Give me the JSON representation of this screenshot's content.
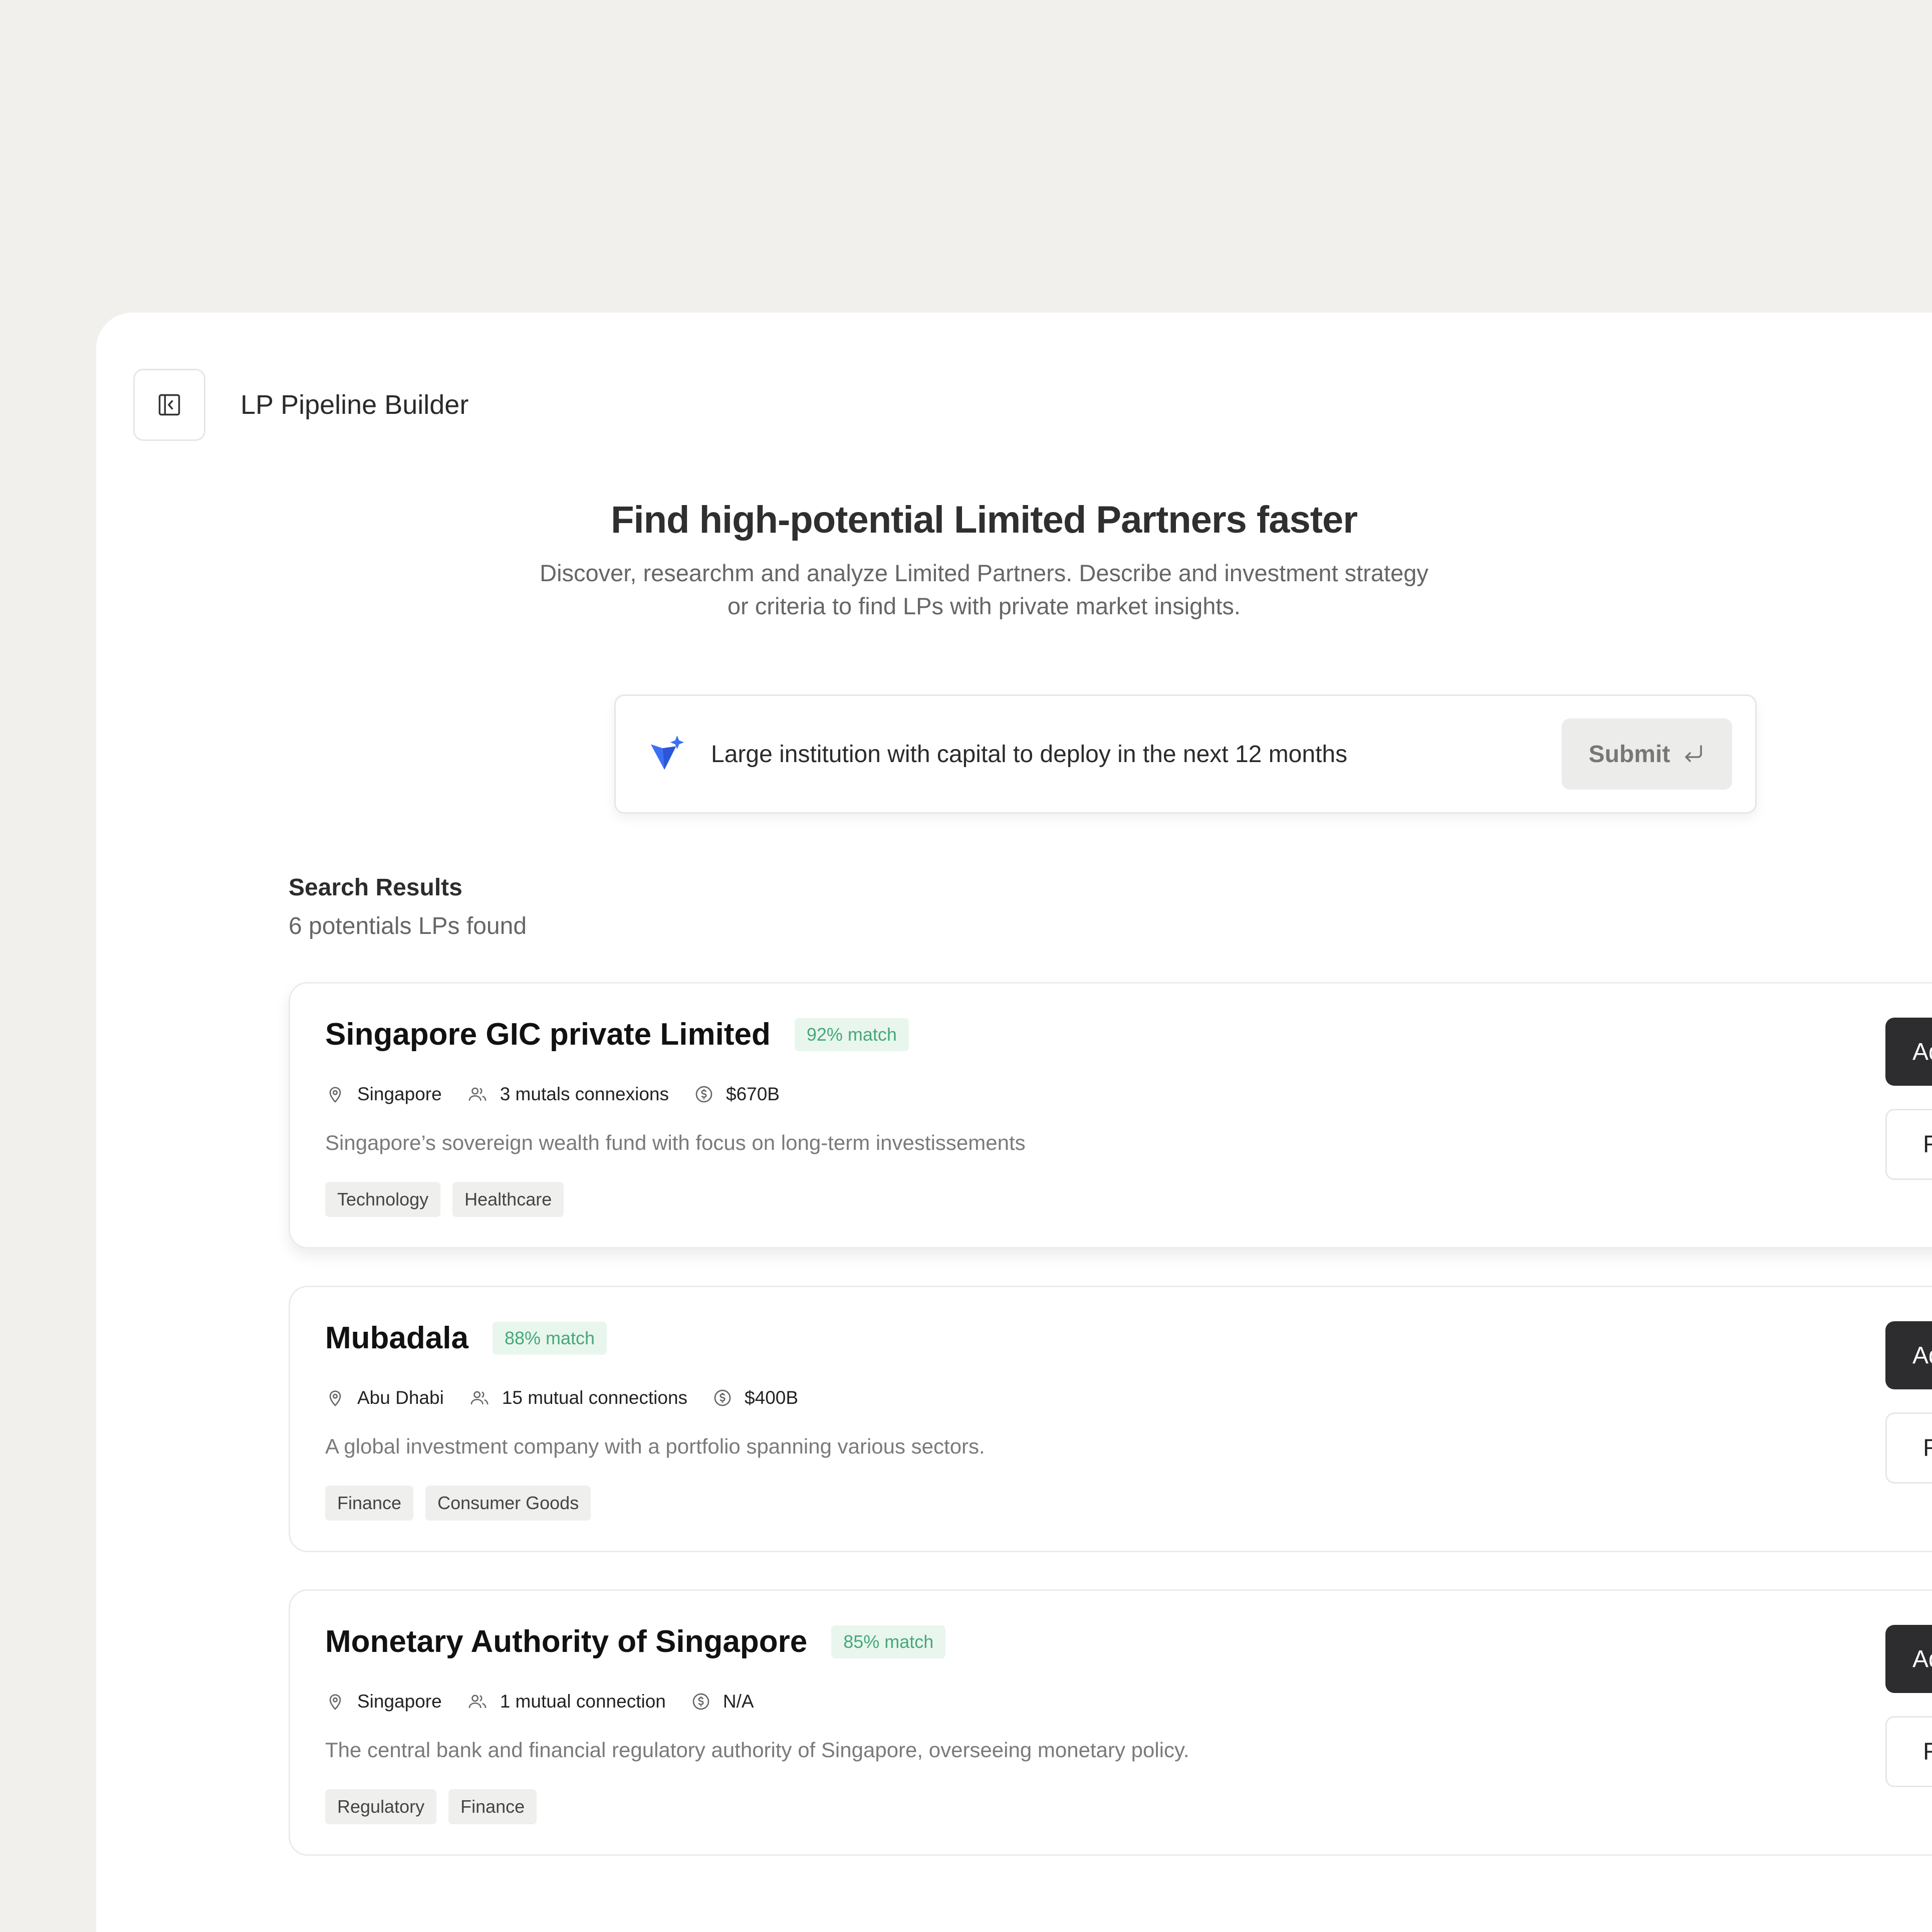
{
  "app": {
    "title": "LP Pipeline Builder"
  },
  "hero": {
    "heading": "Find high-potential Limited Partners faster",
    "subheading": "Discover, researchm and analyze Limited Partners. Describe and investment strategy or criteria to find LPs with private market insights."
  },
  "search": {
    "query": "Large institution with capital to deploy in the next 12 months",
    "submit_label": "Submit"
  },
  "results": {
    "title": "Search Results",
    "count_text": "6 potentials LPs found",
    "items": [
      {
        "name": "Singapore GIC private Limited",
        "match": "92% match",
        "location": "Singapore",
        "connections": "3 mutals connexions",
        "aum": "$670B",
        "description": "Singapore’s sovereign wealth fund with focus on long-term investissements",
        "tags": [
          "Technology",
          "Healthcare"
        ],
        "primary_action": "Add to Pipe",
        "secondary_action": "Request I"
      },
      {
        "name": "Mubadala",
        "match": "88% match",
        "location": "Abu Dhabi",
        "connections": "15 mutual connections",
        "aum": "$400B",
        "description": "A global investment company with a portfolio spanning various sectors.",
        "tags": [
          "Finance",
          "Consumer Goods"
        ],
        "primary_action": "Add to Pipe",
        "secondary_action": "Request I"
      },
      {
        "name": "Monetary Authority of Singapore",
        "match": "85% match",
        "location": "Singapore",
        "connections": "1 mutual connection",
        "aum": "N/A",
        "description": "The central bank and financial regulatory authority of Singapore, overseeing monetary policy.",
        "tags": [
          "Regulatory",
          "Finance"
        ],
        "primary_action": "Add to Pipe",
        "secondary_action": "Request I"
      }
    ]
  },
  "icons": {
    "sidebar_toggle": "panel-collapse-icon",
    "search_logo": "sparkle-logo-icon",
    "submit": "enter-return-icon",
    "location": "map-pin-icon",
    "connections": "users-icon",
    "aum": "dollar-circle-icon"
  },
  "colors": {
    "background": "#f1f0ec",
    "match_text": "#47a877",
    "match_bg": "#e8f6ee",
    "primary_button": "#2d2d2f",
    "brand_blue": "#3b6ff5"
  }
}
